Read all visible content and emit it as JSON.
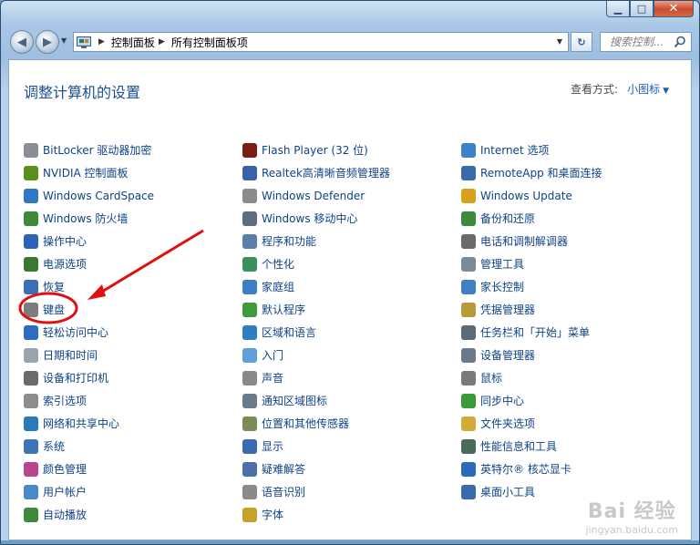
{
  "window": {
    "caption": {
      "minimize": "▁",
      "maximize": "□",
      "close": "✕"
    }
  },
  "nav": {
    "breadcrumb": [
      "控制面板",
      "所有控制面板项"
    ],
    "search_placeholder": "搜索控制...",
    "back_glyph": "◀",
    "forward_glyph": "▶",
    "dropdown_glyph": "▼",
    "refresh_glyph": "↻"
  },
  "header": {
    "title": "调整计算机的设置",
    "view_by_label": "查看方式:",
    "view_by_value": "小图标"
  },
  "columns": [
    [
      {
        "label": "BitLocker 驱动器加密",
        "color": "#8a8f96",
        "icon": "bitlocker-icon"
      },
      {
        "label": "NVIDIA 控制面板",
        "color": "#5a8f1e",
        "icon": "nvidia-icon"
      },
      {
        "label": "Windows CardSpace",
        "color": "#2f78c4",
        "icon": "cardspace-icon"
      },
      {
        "label": "Windows 防火墙",
        "color": "#3c8a3a",
        "icon": "firewall-icon"
      },
      {
        "label": "操作中心",
        "color": "#2c62b8",
        "icon": "action-center-flag-icon"
      },
      {
        "label": "电源选项",
        "color": "#3a7a2e",
        "icon": "power-icon"
      },
      {
        "label": "恢复",
        "color": "#3b6fb5",
        "icon": "recovery-icon"
      },
      {
        "label": "键盘",
        "color": "#7d7d7d",
        "icon": "keyboard-icon"
      },
      {
        "label": "轻松访问中心",
        "color": "#2d6cc0",
        "icon": "ease-of-access-icon"
      },
      {
        "label": "日期和时间",
        "color": "#9aa4b0",
        "icon": "clock-icon"
      },
      {
        "label": "设备和打印机",
        "color": "#6b6b6b",
        "icon": "printer-icon"
      },
      {
        "label": "索引选项",
        "color": "#8c8c8c",
        "icon": "indexing-icon"
      },
      {
        "label": "网络和共享中心",
        "color": "#2b7ab8",
        "icon": "network-icon"
      },
      {
        "label": "系统",
        "color": "#3f73b8",
        "icon": "system-icon"
      },
      {
        "label": "颜色管理",
        "color": "#b8468f",
        "icon": "color-management-icon"
      },
      {
        "label": "用户帐户",
        "color": "#4a8ac8",
        "icon": "user-accounts-icon"
      },
      {
        "label": "自动播放",
        "color": "#3e8a3a",
        "icon": "autoplay-icon"
      }
    ],
    [
      {
        "label": "Flash Player (32 位)",
        "color": "#7a1d12",
        "icon": "flash-icon"
      },
      {
        "label": "Realtek高清晰音频管理器",
        "color": "#3b62a6",
        "icon": "realtek-audio-icon"
      },
      {
        "label": "Windows Defender",
        "color": "#8c8c8c",
        "icon": "defender-icon"
      },
      {
        "label": "Windows 移动中心",
        "color": "#5e6e80",
        "icon": "mobility-center-icon"
      },
      {
        "label": "程序和功能",
        "color": "#5a7fa8",
        "icon": "programs-icon"
      },
      {
        "label": "个性化",
        "color": "#3a8f5a",
        "icon": "personalization-icon"
      },
      {
        "label": "家庭组",
        "color": "#3c7fc4",
        "icon": "homegroup-icon"
      },
      {
        "label": "默认程序",
        "color": "#3d9a3d",
        "icon": "default-programs-icon"
      },
      {
        "label": "区域和语言",
        "color": "#2f7fc0",
        "icon": "region-icon"
      },
      {
        "label": "入门",
        "color": "#5fa0d8",
        "icon": "getting-started-icon"
      },
      {
        "label": "声音",
        "color": "#8a8a8a",
        "icon": "sound-icon"
      },
      {
        "label": "通知区域图标",
        "color": "#6a7a8a",
        "icon": "notification-icon"
      },
      {
        "label": "位置和其他传感器",
        "color": "#7a8a5a",
        "icon": "sensor-icon"
      },
      {
        "label": "显示",
        "color": "#3a6ab0",
        "icon": "display-icon"
      },
      {
        "label": "疑难解答",
        "color": "#4c6fa8",
        "icon": "troubleshoot-icon"
      },
      {
        "label": "语音识别",
        "color": "#8a8a8a",
        "icon": "microphone-icon"
      },
      {
        "label": "字体",
        "color": "#c8a02a",
        "icon": "fonts-icon"
      }
    ],
    [
      {
        "label": "Internet 选项",
        "color": "#3b82c8",
        "icon": "internet-options-icon"
      },
      {
        "label": "RemoteApp 和桌面连接",
        "color": "#3b6aa8",
        "icon": "remoteapp-icon"
      },
      {
        "label": "Windows Update",
        "color": "#d6a21e",
        "icon": "windows-update-icon"
      },
      {
        "label": "备份和还原",
        "color": "#3d8a3d",
        "icon": "backup-icon"
      },
      {
        "label": "电话和调制解调器",
        "color": "#6a6a6a",
        "icon": "phone-modem-icon"
      },
      {
        "label": "管理工具",
        "color": "#7a8a9a",
        "icon": "admin-tools-icon"
      },
      {
        "label": "家长控制",
        "color": "#3f7fc2",
        "icon": "parental-controls-icon"
      },
      {
        "label": "凭据管理器",
        "color": "#b89a3a",
        "icon": "credential-icon"
      },
      {
        "label": "任务栏和「开始」菜单",
        "color": "#5a6a7a",
        "icon": "taskbar-icon"
      },
      {
        "label": "设备管理器",
        "color": "#6a7a8a",
        "icon": "device-manager-icon"
      },
      {
        "label": "鼠标",
        "color": "#7a7a7a",
        "icon": "mouse-icon"
      },
      {
        "label": "同步中心",
        "color": "#3a9a3a",
        "icon": "sync-center-icon"
      },
      {
        "label": "文件夹选项",
        "color": "#d4ab3a",
        "icon": "folder-options-icon"
      },
      {
        "label": "性能信息和工具",
        "color": "#4a6a5a",
        "icon": "performance-icon"
      },
      {
        "label": "英特尔® 核芯显卡",
        "color": "#2a6ab8",
        "icon": "intel-graphics-icon"
      },
      {
        "label": "桌面小工具",
        "color": "#3a6aa8",
        "icon": "gadgets-icon"
      }
    ]
  ],
  "watermark": {
    "line1": "Bai 经验",
    "line2": "jingyan.baidu.com"
  }
}
